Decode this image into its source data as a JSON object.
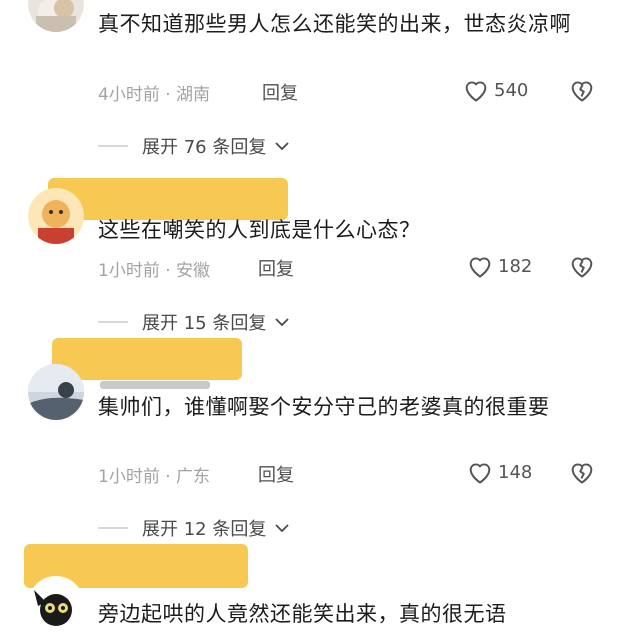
{
  "comments": [
    {
      "text": "真不知道那些男人怎么还能笑的出来，世态炎凉啊",
      "time": "4小时前",
      "location": "湖南",
      "reply_label": "回复",
      "likes": "540",
      "replies_label": "展开 76 条回复"
    },
    {
      "text": "这些在嘲笑的人到底是什么心态？",
      "time": "1小时前",
      "location": "安徽",
      "reply_label": "回复",
      "likes": "182",
      "replies_label": "展开 15 条回复"
    },
    {
      "text": "集帅们，谁懂啊娶个安分守己的老婆真的很重要",
      "time": "1小时前",
      "location": "广东",
      "reply_label": "回复",
      "likes": "148",
      "replies_label": "展开 12 条回复"
    },
    {
      "text": "旁边起哄的人竟然还能笑出来，真的很无语"
    }
  ],
  "colors": {
    "highlight": "#f7c64a",
    "meta": "#a3a3a3",
    "text": "#1c1c1c"
  },
  "icons": {
    "like": "heart-outline-icon",
    "dislike": "broken-heart-icon",
    "expand": "chevron-down-icon"
  }
}
